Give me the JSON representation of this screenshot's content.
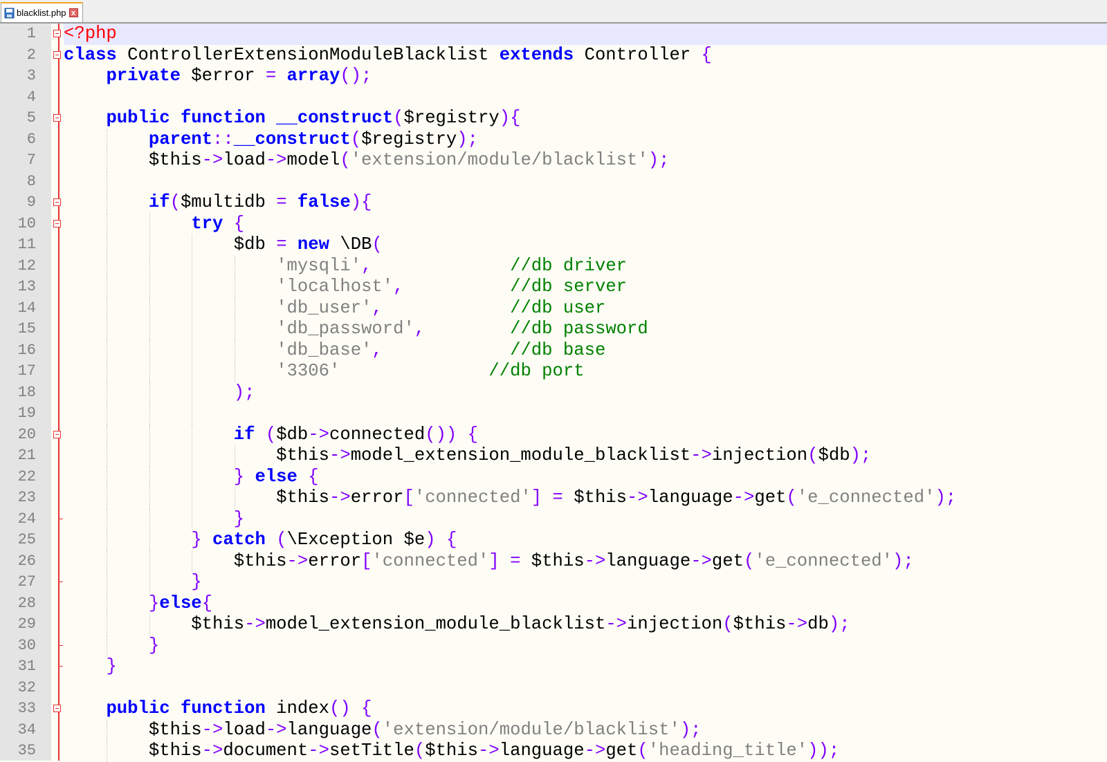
{
  "tab": {
    "filename": "blacklist.php",
    "close_glyph": "x"
  },
  "colors": {
    "keyword": "#0000ff",
    "operator": "#8000ff",
    "string": "#808080",
    "comment": "#008000",
    "php_tag": "#ff0000",
    "current_line": "#e8e8ff",
    "fold_marker": "#e8312f"
  },
  "editor": {
    "current_line": 1,
    "lines": [
      {
        "n": "1",
        "fold": "box",
        "guides": 0,
        "tokens": [
          [
            "php",
            "<?php"
          ]
        ]
      },
      {
        "n": "2",
        "fold": "box",
        "guides": 0,
        "tokens": [
          [
            "kw",
            "class"
          ],
          [
            "",
            "ControllerExtensionModuleBlacklist"
          ],
          [
            "kw",
            "extends"
          ],
          [
            "",
            "Controller"
          ],
          [
            "op",
            "{"
          ]
        ],
        "spaced": true
      },
      {
        "n": "3",
        "fold": "",
        "guides": 0,
        "tokens": [
          [
            "",
            "    "
          ],
          [
            "kw",
            "private"
          ],
          [
            "",
            " $error "
          ],
          [
            "op",
            "="
          ],
          [
            "",
            ""
          ],
          [
            "kw",
            " array"
          ],
          [
            "op",
            "();"
          ]
        ]
      },
      {
        "n": "4",
        "fold": "",
        "guides": 0,
        "tokens": []
      },
      {
        "n": "5",
        "fold": "box",
        "guides": 0,
        "tokens": [
          [
            "",
            "    "
          ],
          [
            "kw",
            "public function __construct"
          ],
          [
            "op",
            "("
          ],
          [
            "",
            "$registry"
          ],
          [
            "op",
            "){"
          ]
        ]
      },
      {
        "n": "6",
        "fold": "",
        "guides": 1,
        "tokens": [
          [
            "",
            "        "
          ],
          [
            "kw",
            "parent"
          ],
          [
            "op",
            "::"
          ],
          [
            "kw",
            "__construct"
          ],
          [
            "op",
            "("
          ],
          [
            "",
            "$registry"
          ],
          [
            "op",
            ");"
          ]
        ]
      },
      {
        "n": "7",
        "fold": "",
        "guides": 1,
        "tokens": [
          [
            "",
            "        $this"
          ],
          [
            "op",
            "->"
          ],
          [
            "",
            "load"
          ],
          [
            "op",
            "->"
          ],
          [
            "",
            "model"
          ],
          [
            "op",
            "("
          ],
          [
            "str",
            "'extension/module/blacklist'"
          ],
          [
            "op",
            ");"
          ]
        ]
      },
      {
        "n": "8",
        "fold": "",
        "guides": 1,
        "tokens": []
      },
      {
        "n": "9",
        "fold": "box",
        "guides": 1,
        "tokens": [
          [
            "",
            "        "
          ],
          [
            "kw",
            "if"
          ],
          [
            "op",
            "("
          ],
          [
            "",
            "$multidb "
          ],
          [
            "op",
            "="
          ],
          [
            "",
            " "
          ],
          [
            "kw",
            "false"
          ],
          [
            "op",
            "){"
          ]
        ]
      },
      {
        "n": "10",
        "fold": "box",
        "guides": 2,
        "tokens": [
          [
            "",
            "            "
          ],
          [
            "kw",
            "try"
          ],
          [
            "",
            " "
          ],
          [
            "op",
            "{"
          ]
        ]
      },
      {
        "n": "11",
        "fold": "",
        "guides": 3,
        "tokens": [
          [
            "",
            "                $db "
          ],
          [
            "op",
            "="
          ],
          [
            "",
            " "
          ],
          [
            "kw",
            "new"
          ],
          [
            "",
            " \\DB"
          ],
          [
            "op",
            "("
          ]
        ]
      },
      {
        "n": "12",
        "fold": "",
        "guides": 4,
        "tokens": [
          [
            "",
            "                    "
          ],
          [
            "str",
            "'mysqli'"
          ],
          [
            "op",
            ","
          ],
          [
            "",
            "             "
          ],
          [
            "cm",
            "//db driver"
          ]
        ]
      },
      {
        "n": "13",
        "fold": "",
        "guides": 4,
        "tokens": [
          [
            "",
            "                    "
          ],
          [
            "str",
            "'localhost'"
          ],
          [
            "op",
            ","
          ],
          [
            "",
            "          "
          ],
          [
            "cm",
            "//db server"
          ]
        ]
      },
      {
        "n": "14",
        "fold": "",
        "guides": 4,
        "tokens": [
          [
            "",
            "                    "
          ],
          [
            "str",
            "'db_user'"
          ],
          [
            "op",
            ","
          ],
          [
            "",
            "            "
          ],
          [
            "cm",
            "//db user"
          ]
        ]
      },
      {
        "n": "15",
        "fold": "",
        "guides": 4,
        "tokens": [
          [
            "",
            "                    "
          ],
          [
            "str",
            "'db_password'"
          ],
          [
            "op",
            ","
          ],
          [
            "",
            "        "
          ],
          [
            "cm",
            "//db password"
          ]
        ]
      },
      {
        "n": "16",
        "fold": "",
        "guides": 4,
        "tokens": [
          [
            "",
            "                    "
          ],
          [
            "str",
            "'db_base'"
          ],
          [
            "op",
            ","
          ],
          [
            "",
            "            "
          ],
          [
            "cm",
            "//db base"
          ]
        ]
      },
      {
        "n": "17",
        "fold": "",
        "guides": 4,
        "tokens": [
          [
            "",
            "                    "
          ],
          [
            "str",
            "'3306'"
          ],
          [
            "",
            "              "
          ],
          [
            "cm",
            "//db port"
          ]
        ]
      },
      {
        "n": "18",
        "fold": "",
        "guides": 3,
        "tokens": [
          [
            "",
            "                "
          ],
          [
            "op",
            ");"
          ]
        ]
      },
      {
        "n": "19",
        "fold": "",
        "guides": 3,
        "tokens": []
      },
      {
        "n": "20",
        "fold": "box",
        "guides": 3,
        "tokens": [
          [
            "",
            "                "
          ],
          [
            "kw",
            "if"
          ],
          [
            "",
            " "
          ],
          [
            "op",
            "("
          ],
          [
            "",
            "$db"
          ],
          [
            "op",
            "->"
          ],
          [
            "",
            "connected"
          ],
          [
            "op",
            "())"
          ],
          [
            "",
            " "
          ],
          [
            "op",
            "{"
          ]
        ]
      },
      {
        "n": "21",
        "fold": "",
        "guides": 4,
        "tokens": [
          [
            "",
            "                    $this"
          ],
          [
            "op",
            "->"
          ],
          [
            "",
            "model_extension_module_blacklist"
          ],
          [
            "op",
            "->"
          ],
          [
            "",
            "injection"
          ],
          [
            "op",
            "("
          ],
          [
            "",
            "$db"
          ],
          [
            "op",
            ");"
          ]
        ]
      },
      {
        "n": "22",
        "fold": "",
        "guides": 3,
        "tokens": [
          [
            "",
            "                "
          ],
          [
            "op",
            "}"
          ],
          [
            "",
            " "
          ],
          [
            "kw",
            "else"
          ],
          [
            "",
            " "
          ],
          [
            "op",
            "{"
          ]
        ]
      },
      {
        "n": "23",
        "fold": "",
        "guides": 4,
        "tokens": [
          [
            "",
            "                    $this"
          ],
          [
            "op",
            "->"
          ],
          [
            "",
            "error"
          ],
          [
            "op",
            "["
          ],
          [
            "str",
            "'connected'"
          ],
          [
            "op",
            "]"
          ],
          [
            "",
            " "
          ],
          [
            "op",
            "="
          ],
          [
            "",
            " $this"
          ],
          [
            "op",
            "->"
          ],
          [
            "",
            "language"
          ],
          [
            "op",
            "->"
          ],
          [
            "",
            "get"
          ],
          [
            "op",
            "("
          ],
          [
            "str",
            "'e_connected'"
          ],
          [
            "op",
            ");"
          ]
        ]
      },
      {
        "n": "24",
        "fold": "end",
        "guides": 3,
        "tokens": [
          [
            "",
            "                "
          ],
          [
            "op",
            "}"
          ]
        ]
      },
      {
        "n": "25",
        "fold": "",
        "guides": 2,
        "tokens": [
          [
            "",
            "            "
          ],
          [
            "op",
            "}"
          ],
          [
            "",
            " "
          ],
          [
            "kw",
            "catch"
          ],
          [
            "",
            " "
          ],
          [
            "op",
            "("
          ],
          [
            "",
            "\\Exception $e"
          ],
          [
            "op",
            ")"
          ],
          [
            "",
            " "
          ],
          [
            "op",
            "{"
          ]
        ]
      },
      {
        "n": "26",
        "fold": "",
        "guides": 3,
        "tokens": [
          [
            "",
            "                $this"
          ],
          [
            "op",
            "->"
          ],
          [
            "",
            "error"
          ],
          [
            "op",
            "["
          ],
          [
            "str",
            "'connected'"
          ],
          [
            "op",
            "]"
          ],
          [
            "",
            " "
          ],
          [
            "op",
            "="
          ],
          [
            "",
            " $this"
          ],
          [
            "op",
            "->"
          ],
          [
            "",
            "language"
          ],
          [
            "op",
            "->"
          ],
          [
            "",
            "get"
          ],
          [
            "op",
            "("
          ],
          [
            "str",
            "'e_connected'"
          ],
          [
            "op",
            ");"
          ]
        ]
      },
      {
        "n": "27",
        "fold": "end",
        "guides": 2,
        "tokens": [
          [
            "",
            "            "
          ],
          [
            "op",
            "}"
          ]
        ]
      },
      {
        "n": "28",
        "fold": "",
        "guides": 1,
        "tokens": [
          [
            "",
            "        "
          ],
          [
            "op",
            "}"
          ],
          [
            "kw",
            "else"
          ],
          [
            "op",
            "{"
          ]
        ]
      },
      {
        "n": "29",
        "fold": "",
        "guides": 2,
        "tokens": [
          [
            "",
            "            $this"
          ],
          [
            "op",
            "->"
          ],
          [
            "",
            "model_extension_module_blacklist"
          ],
          [
            "op",
            "->"
          ],
          [
            "",
            "injection"
          ],
          [
            "op",
            "("
          ],
          [
            "",
            "$this"
          ],
          [
            "op",
            "->"
          ],
          [
            "",
            "db"
          ],
          [
            "op",
            ");"
          ]
        ]
      },
      {
        "n": "30",
        "fold": "end",
        "guides": 1,
        "tokens": [
          [
            "",
            "        "
          ],
          [
            "op",
            "}"
          ]
        ]
      },
      {
        "n": "31",
        "fold": "end",
        "guides": 0,
        "tokens": [
          [
            "",
            "    "
          ],
          [
            "op",
            "}"
          ]
        ]
      },
      {
        "n": "32",
        "fold": "",
        "guides": 0,
        "tokens": []
      },
      {
        "n": "33",
        "fold": "box",
        "guides": 0,
        "tokens": [
          [
            "",
            "    "
          ],
          [
            "kw",
            "public function"
          ],
          [
            "",
            " index"
          ],
          [
            "op",
            "()"
          ],
          [
            "",
            " "
          ],
          [
            "op",
            "{"
          ]
        ]
      },
      {
        "n": "34",
        "fold": "",
        "guides": 1,
        "tokens": [
          [
            "",
            "        $this"
          ],
          [
            "op",
            "->"
          ],
          [
            "",
            "load"
          ],
          [
            "op",
            "->"
          ],
          [
            "",
            "language"
          ],
          [
            "op",
            "("
          ],
          [
            "str",
            "'extension/module/blacklist'"
          ],
          [
            "op",
            ");"
          ]
        ]
      },
      {
        "n": "35",
        "fold": "",
        "guides": 1,
        "tokens": [
          [
            "",
            "        $this"
          ],
          [
            "op",
            "->"
          ],
          [
            "",
            "document"
          ],
          [
            "op",
            "->"
          ],
          [
            "",
            "setTitle"
          ],
          [
            "op",
            "("
          ],
          [
            "",
            "$this"
          ],
          [
            "op",
            "->"
          ],
          [
            "",
            "language"
          ],
          [
            "op",
            "->"
          ],
          [
            "",
            "get"
          ],
          [
            "op",
            "("
          ],
          [
            "str",
            "'heading_title'"
          ],
          [
            "op",
            "));"
          ]
        ]
      }
    ]
  }
}
